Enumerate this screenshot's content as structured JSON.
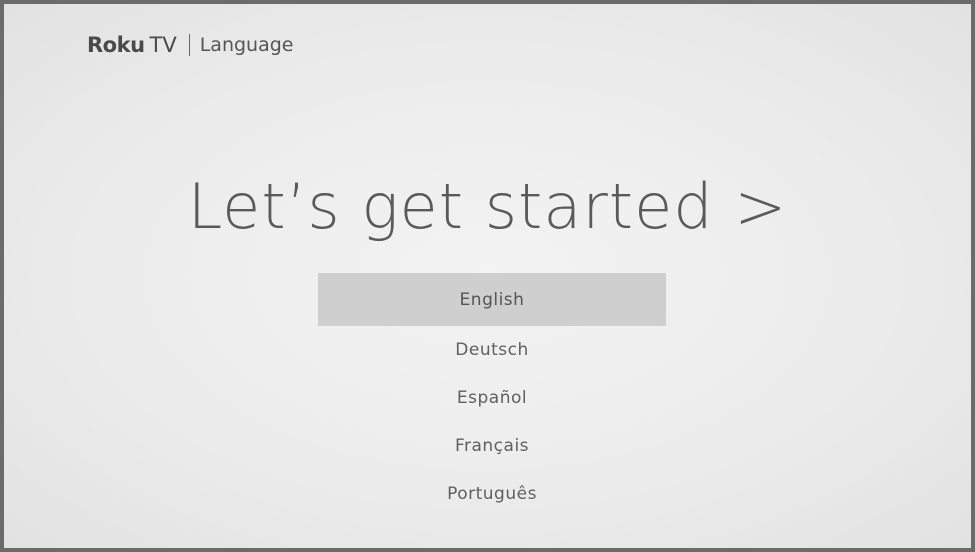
{
  "header": {
    "brand_primary": "Roku",
    "brand_secondary": "TV",
    "section_title": "Language"
  },
  "main": {
    "heading": "Let’s get started >",
    "languages": [
      {
        "label": "English",
        "selected": true
      },
      {
        "label": "Deutsch",
        "selected": false
      },
      {
        "label": "Español",
        "selected": false
      },
      {
        "label": "Français",
        "selected": false
      },
      {
        "label": "Português",
        "selected": false
      }
    ]
  },
  "colors": {
    "background": "#ececec",
    "frame_border": "#6b6b6b",
    "selected_highlight": "#cfcfcf",
    "text": "#5e5e5e"
  }
}
